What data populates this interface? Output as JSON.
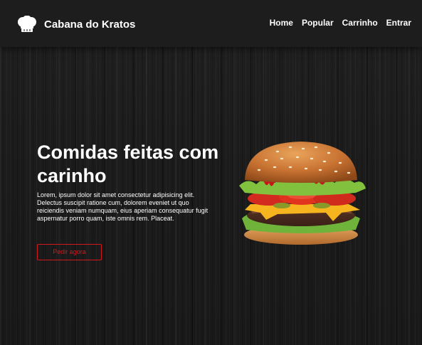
{
  "navbar": {
    "logo_icon": "chef-hat-icon",
    "brand": "Cabana do Kratos",
    "links": [
      "Home",
      "Popular",
      "Carrinho",
      "Entrar"
    ]
  },
  "hero": {
    "title": "Comidas feitas com carinho",
    "text": "Lorem, ipsum dolor sit amet consectetur adipisicing elit. Delectus suscipit ratione cum, dolorem eveniet ut quo reiciendis veniam numquam, eius aperiam consequatur fugit aspernatur porro quam, iste omnis rem. Placeat.",
    "cta": "Pedir agora",
    "image": "hamburger-image"
  },
  "colors": {
    "accent": "#d1191d",
    "text": "#ffffff",
    "background": "#1c1c1c"
  }
}
